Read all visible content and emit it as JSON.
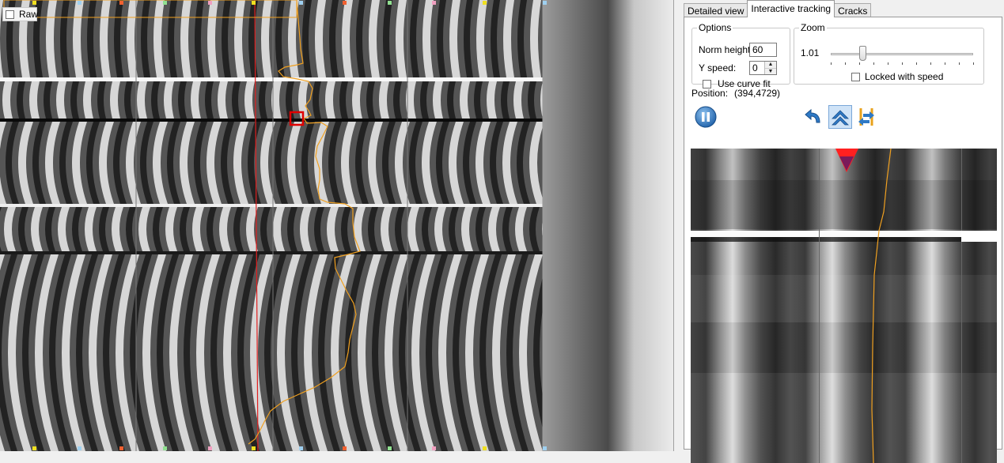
{
  "raw_toggle": {
    "label": "Raw",
    "checked": false
  },
  "tabs": [
    {
      "label": "Detailed view",
      "active": false
    },
    {
      "label": "Interactive tracking",
      "active": true
    },
    {
      "label": "Cracks",
      "active": false
    }
  ],
  "options": {
    "title": "Options",
    "norm_height_label": "Norm height",
    "norm_height_value": "60",
    "y_speed_label": "Y speed:",
    "y_speed_value": "0",
    "curve_fit_label": "Use curve fit",
    "curve_fit_checked": false
  },
  "zoom": {
    "title": "Zoom",
    "value_text": "1.01",
    "locked_label": "Locked with speed",
    "locked_checked": false,
    "slider_fraction": 0.22
  },
  "position": {
    "label": "Position:",
    "value": "(394,4729)"
  },
  "toolbar": {
    "pause": "pause-icon",
    "undo": "undo-arrow-icon",
    "move_up": "double-chevron-up-icon",
    "swap": "swap-arrows-icon"
  },
  "colors": {
    "trace": "#f0a020",
    "cursor_line": "#e02020",
    "selection_box": "#e00000",
    "marker": "#ff2020"
  }
}
